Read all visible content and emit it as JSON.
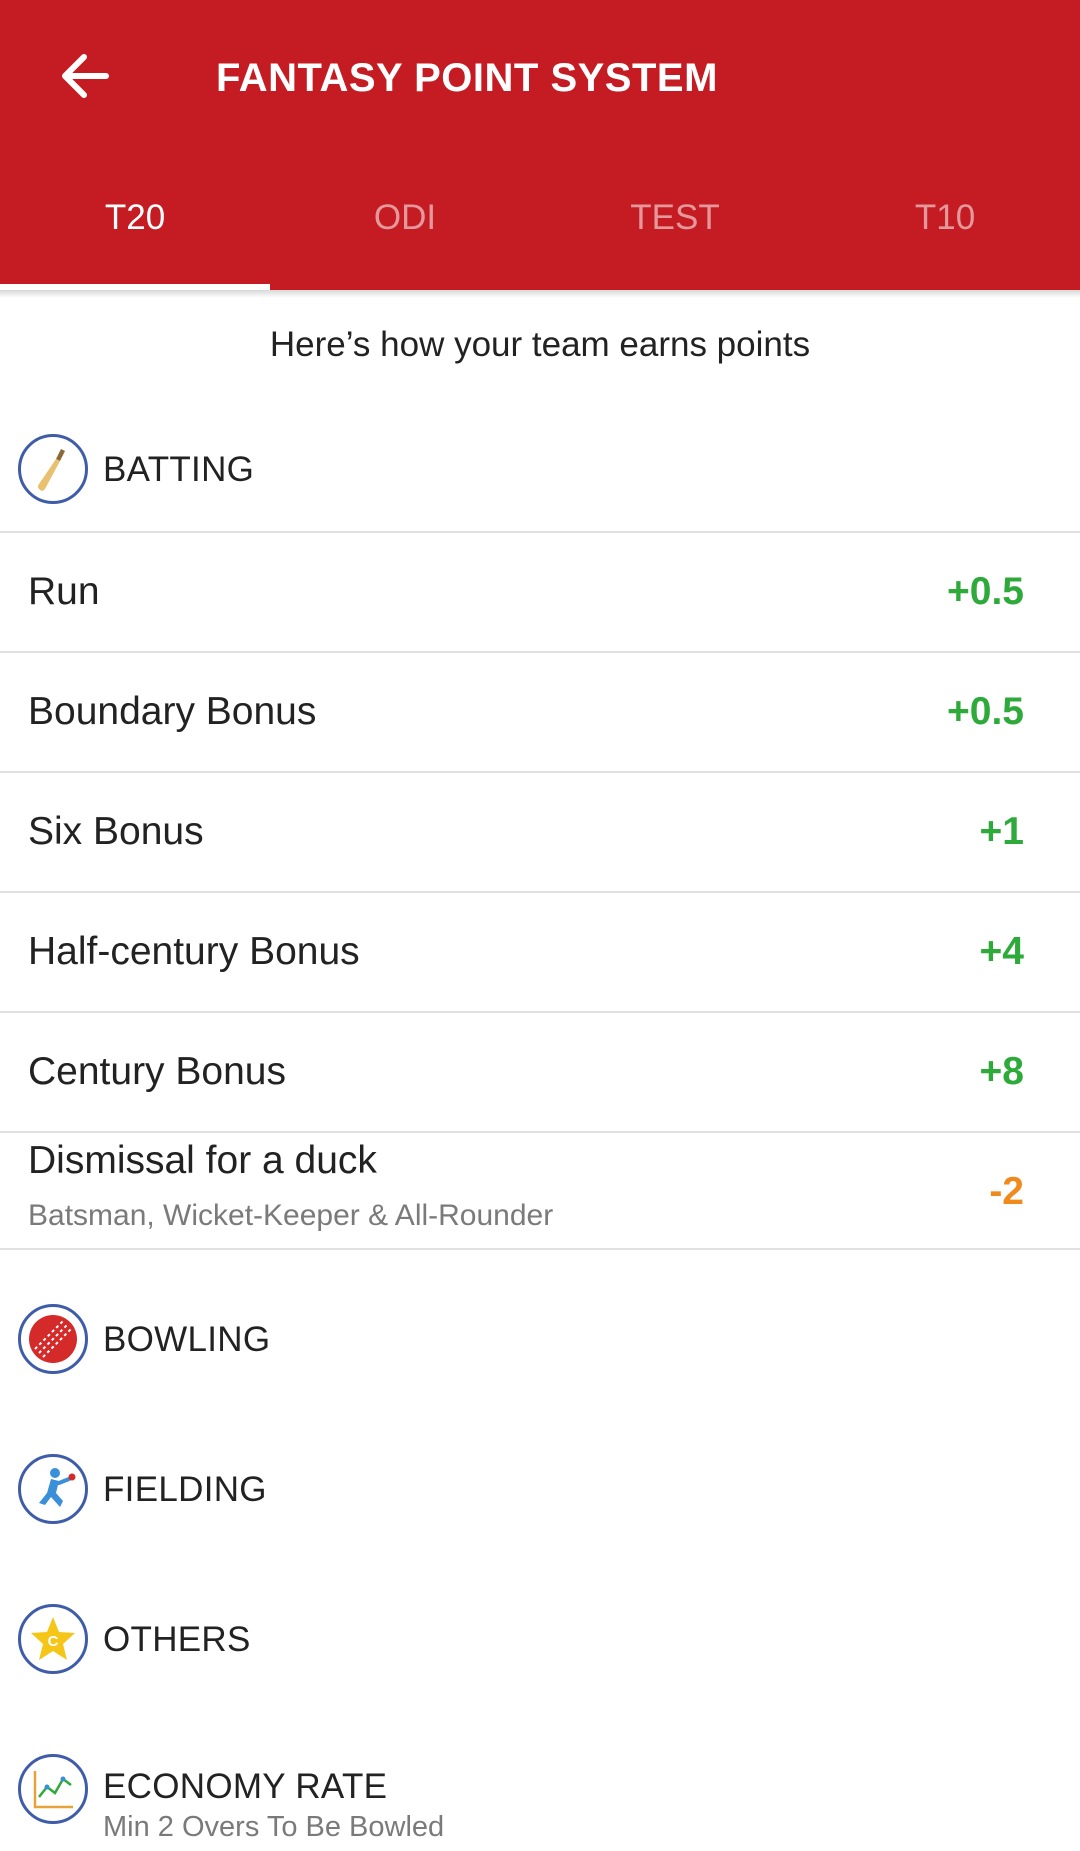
{
  "header": {
    "title": "FANTASY POINT SYSTEM",
    "back_icon": "arrow-left-icon",
    "background_color": "#c41c22"
  },
  "tabs": [
    {
      "label": "T20",
      "active": true
    },
    {
      "label": "ODI",
      "active": false
    },
    {
      "label": "TEST",
      "active": false
    },
    {
      "label": "T10",
      "active": false
    }
  ],
  "intro": "Here’s how your team earns points",
  "colors": {
    "positive": "#2eaa3b",
    "negative": "#f08a1c",
    "icon_ring": "#3f5ca8"
  },
  "sections": {
    "batting": {
      "label": "BATTING",
      "icon": "cricket-bat-icon",
      "rows": [
        {
          "name": "Run",
          "points": "+0.5"
        },
        {
          "name": "Boundary Bonus",
          "points": "+0.5"
        },
        {
          "name": "Six Bonus",
          "points": "+1"
        },
        {
          "name": "Half-century Bonus",
          "points": "+4"
        },
        {
          "name": "Century Bonus",
          "points": "+8"
        },
        {
          "name": "Dismissal for a duck",
          "description": "Batsman, Wicket-Keeper & All-Rounder",
          "points": "-2"
        }
      ]
    },
    "bowling": {
      "label": "BOWLING",
      "icon": "cricket-ball-icon"
    },
    "fielding": {
      "label": "FIELDING",
      "icon": "fielder-icon"
    },
    "others": {
      "label": "OTHERS",
      "icon": "captain-star-icon"
    },
    "economy": {
      "label": "ECONOMY RATE",
      "sub": "Min 2 Overs To Be Bowled",
      "icon": "line-chart-icon"
    }
  }
}
